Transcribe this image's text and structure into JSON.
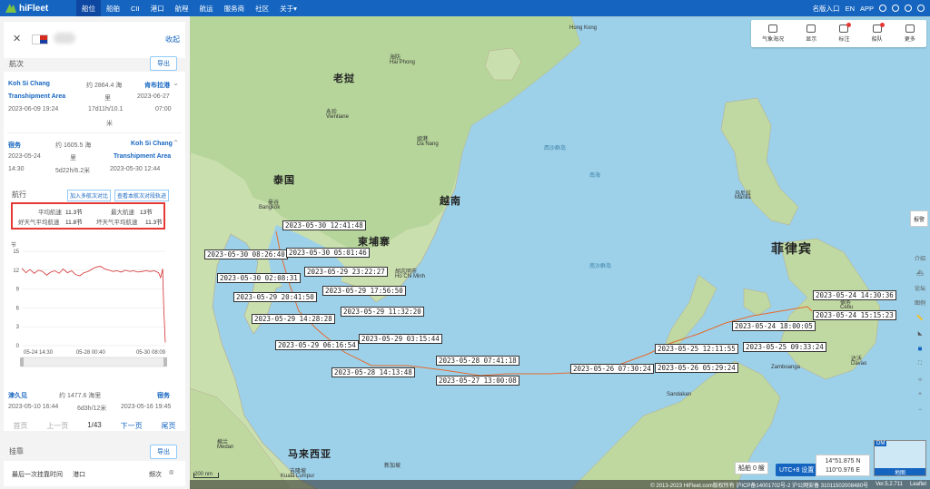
{
  "app": {
    "name": "hiFleet"
  },
  "nav": {
    "items": [
      "船位",
      "船舶",
      "CII",
      "港口",
      "航程",
      "航运",
      "服务商",
      "社区",
      "关于▾"
    ],
    "right": [
      "名版入口",
      "EN",
      "APP"
    ]
  },
  "ship": {
    "collapse": "收起"
  },
  "voyage": {
    "title": "航次",
    "export": "导出",
    "v1": {
      "from": "Koh Si Chang",
      "to": "肯布拉港",
      "from2": "Transhipment Area",
      "dist_label": "约 2864.4 海",
      "dist_unit": "里",
      "dist_unit2": "米",
      "duration": "17d11h/10.1",
      "arrive_date": "2023-06-27",
      "arrive_time": "07:00",
      "depart": "2023-06-09 19:24"
    },
    "v2": {
      "from": "宿务",
      "dist_label": "约 1605.5 海",
      "to": "Koh Si Chang",
      "to2": "Transhipment Area",
      "depart_date": "2023-05-24",
      "depart_time": "14:30",
      "dist_unit": "里",
      "duration": "5d22h/6.2米",
      "arrive": "2023-05-30 12:44"
    },
    "voyage_title": "航行",
    "btn_compare": "加入多航次对比",
    "btn_track": "查看本航次对段轨迹",
    "avg_speed_label": "平均航速",
    "avg_speed": "11.3节",
    "max_speed_label": "最大航速",
    "max_speed": "13节",
    "good_wx_label": "好天气平均航速",
    "good_wx": "11.8节",
    "bad_wx_label": "坏天气平均航速",
    "bad_wx": "11.3节",
    "v3": {
      "from": "津久见",
      "dist_label": "约 1477.6 海里",
      "to": "宿务",
      "depart": "2023-05-10 16:44",
      "duration": "6d3h/12米",
      "arrive": "2023-05-16 19:45"
    },
    "pager": {
      "first": "首页",
      "prev": "上一页",
      "page": "1/43",
      "next": "下一页",
      "last": "尾页"
    }
  },
  "stop": {
    "title": "挂靠",
    "export": "导出",
    "col1": "最后一次挂靠时间",
    "col2": "港口",
    "col3": "频次"
  },
  "chart_data": {
    "type": "line",
    "ylabel": "节",
    "ylim": [
      0,
      15
    ],
    "yticks": [
      0,
      3,
      6,
      9,
      12,
      15
    ],
    "xticks": [
      "05-24 14:30",
      "05-28 00:40",
      "05-30 08:09"
    ],
    "x": [
      0,
      4,
      8,
      12,
      16,
      20,
      24,
      28,
      32,
      36,
      40,
      44,
      48,
      52,
      56,
      60,
      64,
      68,
      72,
      76,
      80,
      84,
      88,
      92,
      96,
      100,
      104,
      108,
      112,
      116,
      120,
      124,
      128,
      132,
      134,
      136,
      137,
      138,
      138.5
    ],
    "values": [
      12.3,
      11.6,
      12.1,
      11.5,
      12.0,
      11.8,
      11.2,
      11.7,
      11.9,
      11.5,
      12.2,
      11.6,
      11.9,
      11.3,
      11.1,
      11.6,
      11.8,
      12.2,
      12.5,
      12.6,
      12.2,
      12.0,
      11.8,
      11.9,
      11.7,
      12.0,
      11.8,
      11.9,
      11.7,
      11.8,
      11.9,
      11.8,
      11.9,
      11.6,
      10.8,
      12.2,
      6.0,
      2.5,
      0.5
    ]
  },
  "map": {
    "tools": [
      "气象海况",
      "显示",
      "标注",
      "船队",
      "更多"
    ],
    "side": [
      "报警",
      "介绍",
      "论坛",
      "图例"
    ],
    "labels": [
      "2023-05-30 12:41:48",
      "2023-05-30 08:26:40",
      "2023-05-30 05:01:46",
      "2023-05-30 02:08:31",
      "2023-05-29 23:22:27",
      "2023-05-29 20:41:50",
      "2023-05-29 17:56:50",
      "2023-05-29 14:28:28",
      "2023-05-29 11:32:20",
      "2023-05-29 06:16:54",
      "2023-05-29 03:15:44",
      "2023-05-28 14:13:48",
      "2023-05-28 07:41:18",
      "2023-05-27 13:00:08",
      "2023-05-26 07:30:24",
      "2023-05-26 05:29:24",
      "2023-05-25 12:11:55",
      "2023-05-25 09:33:24",
      "2023-05-24 18:00:05",
      "2023-05-24 15:15:23",
      "2023-05-24 14:30:36"
    ],
    "countries": [
      "老挝",
      "泰国",
      "柬埔寨",
      "越南",
      "菲律宾",
      "马来西亚"
    ],
    "places": [
      "Hong Kong",
      "曼谷",
      "胡志明市",
      "Ho Chi Minh",
      "马尼拉",
      "Manila",
      "宿务",
      "Cebu",
      "达沃",
      "Davao",
      "吉隆坡",
      "Kuala Lumpur",
      "新加坡",
      "Sandakan",
      "Zamboanga",
      "棉兰",
      "Medan",
      "Bangkok",
      "永珍",
      "Vientiane",
      "海防",
      "Hai Phong",
      "岘港",
      "Da Nang"
    ],
    "seas": [
      "西沙群岛",
      "南海",
      "南沙群岛"
    ],
    "ships_count": "船舶 0 艘",
    "utc": "UTC+8 设置",
    "coords_lat": "14°51.875 N",
    "coords_lon": "110°0.976 E",
    "dm": "DM",
    "minimap": "地图",
    "scale": "200 nm",
    "copyright": "© 2013-2023 HiFleet.com版权所有 沪ICP备14001702号-2 沪公网安备 31011502008480号",
    "version": "Ver.5.2.711",
    "leaflet": "Leaflet"
  }
}
